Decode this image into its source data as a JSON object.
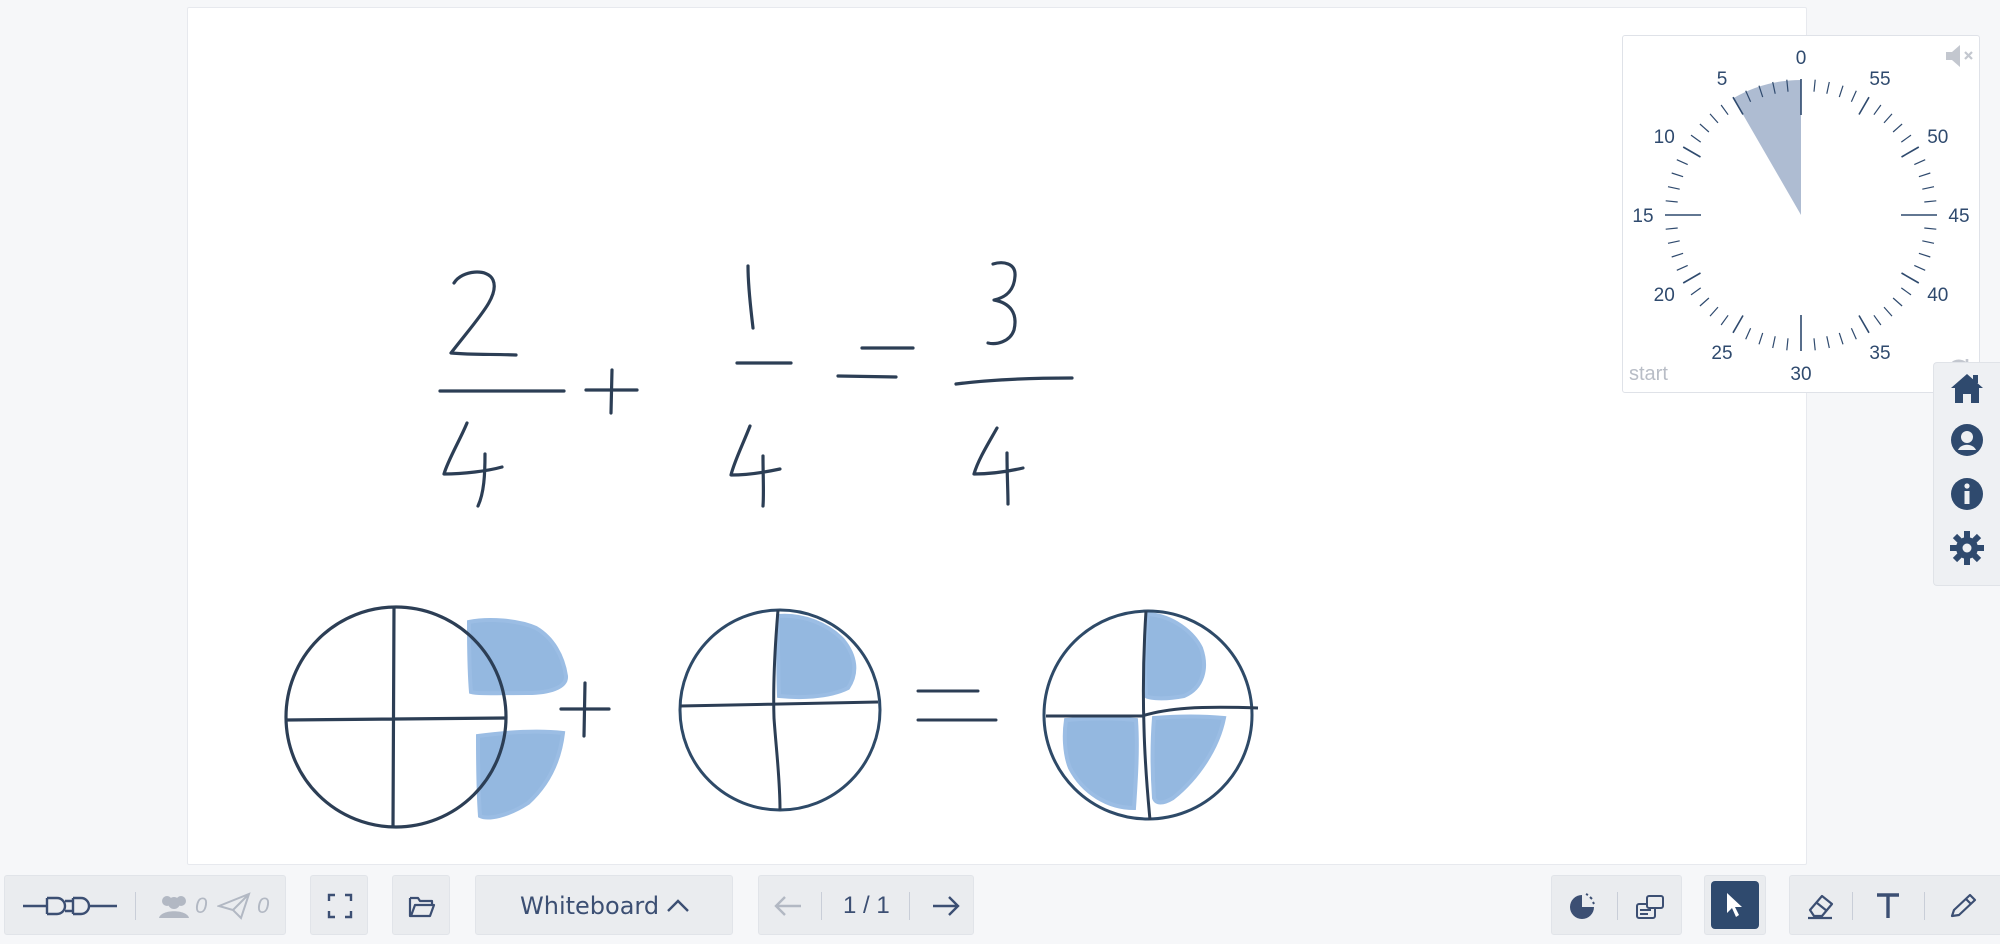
{
  "whiteboard": {
    "title": "Whiteboard",
    "handwriting": {
      "fraction1": {
        "numerator": "2",
        "denominator": "4"
      },
      "plus": "+",
      "fraction2": {
        "numerator": "1",
        "denominator": "4"
      },
      "equals": "=",
      "result": {
        "numerator": "3",
        "denominator": "4"
      }
    },
    "ink_color": "#2c3e55",
    "fill_color": "#94b8e0"
  },
  "timer": {
    "dial_labels": [
      "0",
      "55",
      "50",
      "45",
      "40",
      "35",
      "30",
      "25",
      "20",
      "15",
      "10",
      "5"
    ],
    "set_minutes": 5,
    "start_label": "start",
    "mute_icon": "speaker-muted-icon",
    "reset_icon": "reset-icon",
    "sector_color": "#aebcd2"
  },
  "sidenav": {
    "items": [
      {
        "name": "home",
        "icon": "home-icon"
      },
      {
        "name": "profile",
        "icon": "user-icon"
      },
      {
        "name": "info",
        "icon": "info-icon"
      },
      {
        "name": "settings",
        "icon": "gear-icon"
      }
    ]
  },
  "toolbar": {
    "connection_icon": "plug-icon",
    "participants_count": "0",
    "messages_count": "0",
    "board_selector_label": "Whiteboard",
    "page_indicator": "1 / 1",
    "tools": [
      "timer-icon",
      "cards-icon",
      "select-icon",
      "eraser-icon",
      "text-icon",
      "pen-icon"
    ],
    "accent": "#2f4a6e"
  }
}
